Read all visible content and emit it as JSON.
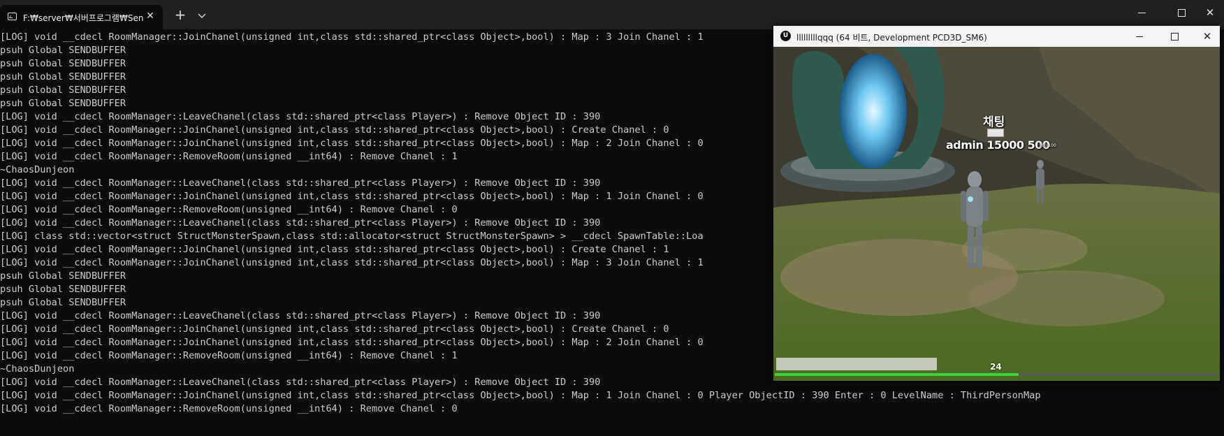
{
  "terminal": {
    "tab_title": "F:₩server₩서버프로그램₩Sen",
    "tab_close": "✕",
    "new_tab": "+",
    "lines": [
      "[LOG] void __cdecl RoomManager::JoinChanel(unsigned int,class std::shared_ptr<class Object>,bool) : Map : 3 Join Chanel : 1",
      "psuh Global SENDBUFFER",
      "psuh Global SENDBUFFER",
      "psuh Global SENDBUFFER",
      "psuh Global SENDBUFFER",
      "psuh Global SENDBUFFER",
      "[LOG] void __cdecl RoomManager::LeaveChanel(class std::shared_ptr<class Player>) : Remove Object ID : 390",
      "[LOG] void __cdecl RoomManager::JoinChanel(unsigned int,class std::shared_ptr<class Object>,bool) : Create Chanel : 0",
      "[LOG] void __cdecl RoomManager::JoinChanel(unsigned int,class std::shared_ptr<class Object>,bool) : Map : 2 Join Chanel : 0",
      "[LOG] void __cdecl RoomManager::RemoveRoom(unsigned __int64) : Remove Chanel : 1",
      "~ChaosDunjeon",
      "[LOG] void __cdecl RoomManager::LeaveChanel(class std::shared_ptr<class Player>) : Remove Object ID : 390",
      "[LOG] void __cdecl RoomManager::JoinChanel(unsigned int,class std::shared_ptr<class Object>,bool) : Map : 1 Join Chanel : 0",
      "[LOG] void __cdecl RoomManager::RemoveRoom(unsigned __int64) : Remove Chanel : 0",
      "[LOG] void __cdecl RoomManager::LeaveChanel(class std::shared_ptr<class Player>) : Remove Object ID : 390",
      "[LOG] class std::vector<struct StructMonsterSpawn,class std::allocator<struct StructMonsterSpawn> > __cdecl SpawnTable::Loa",
      "[LOG] void __cdecl RoomManager::JoinChanel(unsigned int,class std::shared_ptr<class Object>,bool) : Create Chanel : 1",
      "[LOG] void __cdecl RoomManager::JoinChanel(unsigned int,class std::shared_ptr<class Object>,bool) : Map : 3 Join Chanel : 1",
      "psuh Global SENDBUFFER",
      "psuh Global SENDBUFFER",
      "psuh Global SENDBUFFER",
      "[LOG] void __cdecl RoomManager::LeaveChanel(class std::shared_ptr<class Player>) : Remove Object ID : 390",
      "[LOG] void __cdecl RoomManager::JoinChanel(unsigned int,class std::shared_ptr<class Object>,bool) : Create Chanel : 0",
      "[LOG] void __cdecl RoomManager::JoinChanel(unsigned int,class std::shared_ptr<class Object>,bool) : Map : 2 Join Chanel : 0",
      "[LOG] void __cdecl RoomManager::RemoveRoom(unsigned __int64) : Remove Chanel : 1",
      "~ChaosDunjeon",
      "[LOG] void __cdecl RoomManager::LeaveChanel(class std::shared_ptr<class Player>) : Remove Object ID : 390",
      "[LOG] void __cdecl RoomManager::JoinChanel(unsigned int,class std::shared_ptr<class Object>,bool) : Map : 1 Join Chanel : 0 Player ObjectID : 390 Enter : 0 LevelName : ThirdPersonMap",
      "[LOG] void __cdecl RoomManager::RemoveRoom(unsigned __int64) : Remove Chanel : 0"
    ]
  },
  "game": {
    "window_title": "lllllllllqqq (64 비트, Development PCD3D_SM6)",
    "app_icon": "unreal-engine-icon",
    "chat_label": "채팅",
    "player_stats": "admin 15000 500",
    "player_stats_small": "100 100",
    "level": "24",
    "hp_ratio": 0.55
  },
  "colors": {
    "terminal_bg": "#0c0c0c",
    "terminal_text": "#cccccc",
    "hp_bar": "#3cd23c"
  }
}
